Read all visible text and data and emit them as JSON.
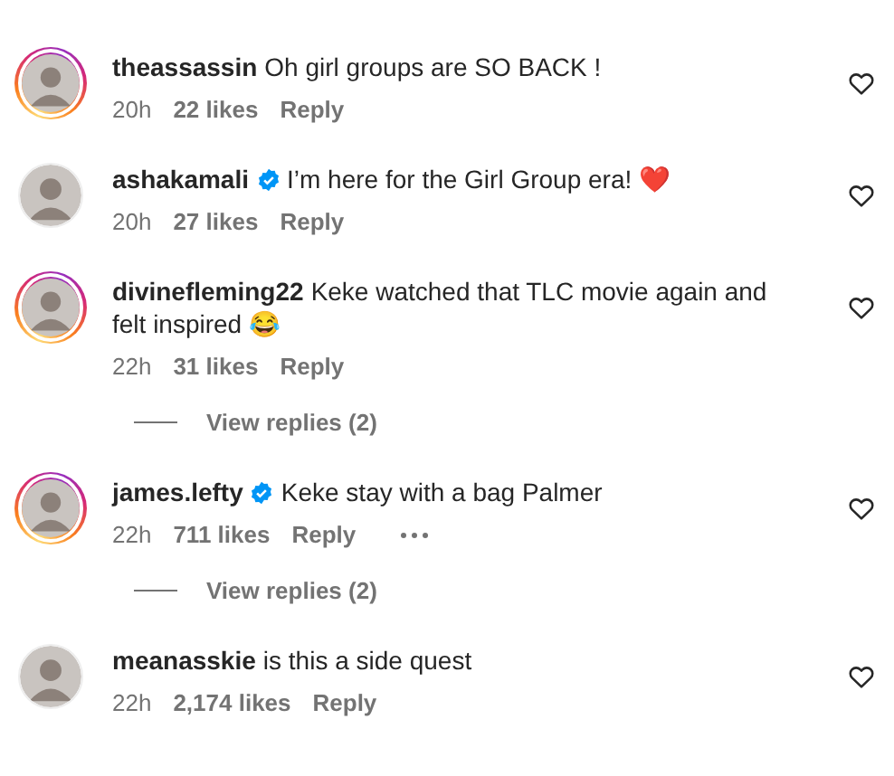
{
  "comments": [
    {
      "kind": "comment",
      "username": "theassassin",
      "verified": false,
      "story_ring": true,
      "text": "Oh girl groups are SO BACK !",
      "time": "20h",
      "likes": "22 likes",
      "reply": "Reply",
      "more": false
    },
    {
      "kind": "comment",
      "username": "ashakamali",
      "verified": true,
      "story_ring": false,
      "text": "I’m here for the Girl Group era! ❤️",
      "time": "20h",
      "likes": "27 likes",
      "reply": "Reply",
      "more": false
    },
    {
      "kind": "comment",
      "username": "divinefleming22",
      "verified": false,
      "story_ring": true,
      "text": "Keke watched that TLC movie again and felt inspired 😂",
      "time": "22h",
      "likes": "31 likes",
      "reply": "Reply",
      "more": false
    },
    {
      "kind": "replies",
      "label": "View replies (2)"
    },
    {
      "kind": "comment",
      "username": "james.lefty",
      "verified": true,
      "story_ring": true,
      "text": "Keke stay with a bag Palmer",
      "time": "22h",
      "likes": "711 likes",
      "reply": "Reply",
      "more": true
    },
    {
      "kind": "replies",
      "label": "View replies (2)"
    },
    {
      "kind": "comment",
      "username": "meanasskie",
      "verified": false,
      "story_ring": false,
      "text": "is this a side quest",
      "time": "22h",
      "likes": "2,174 likes",
      "reply": "Reply",
      "more": false
    }
  ]
}
